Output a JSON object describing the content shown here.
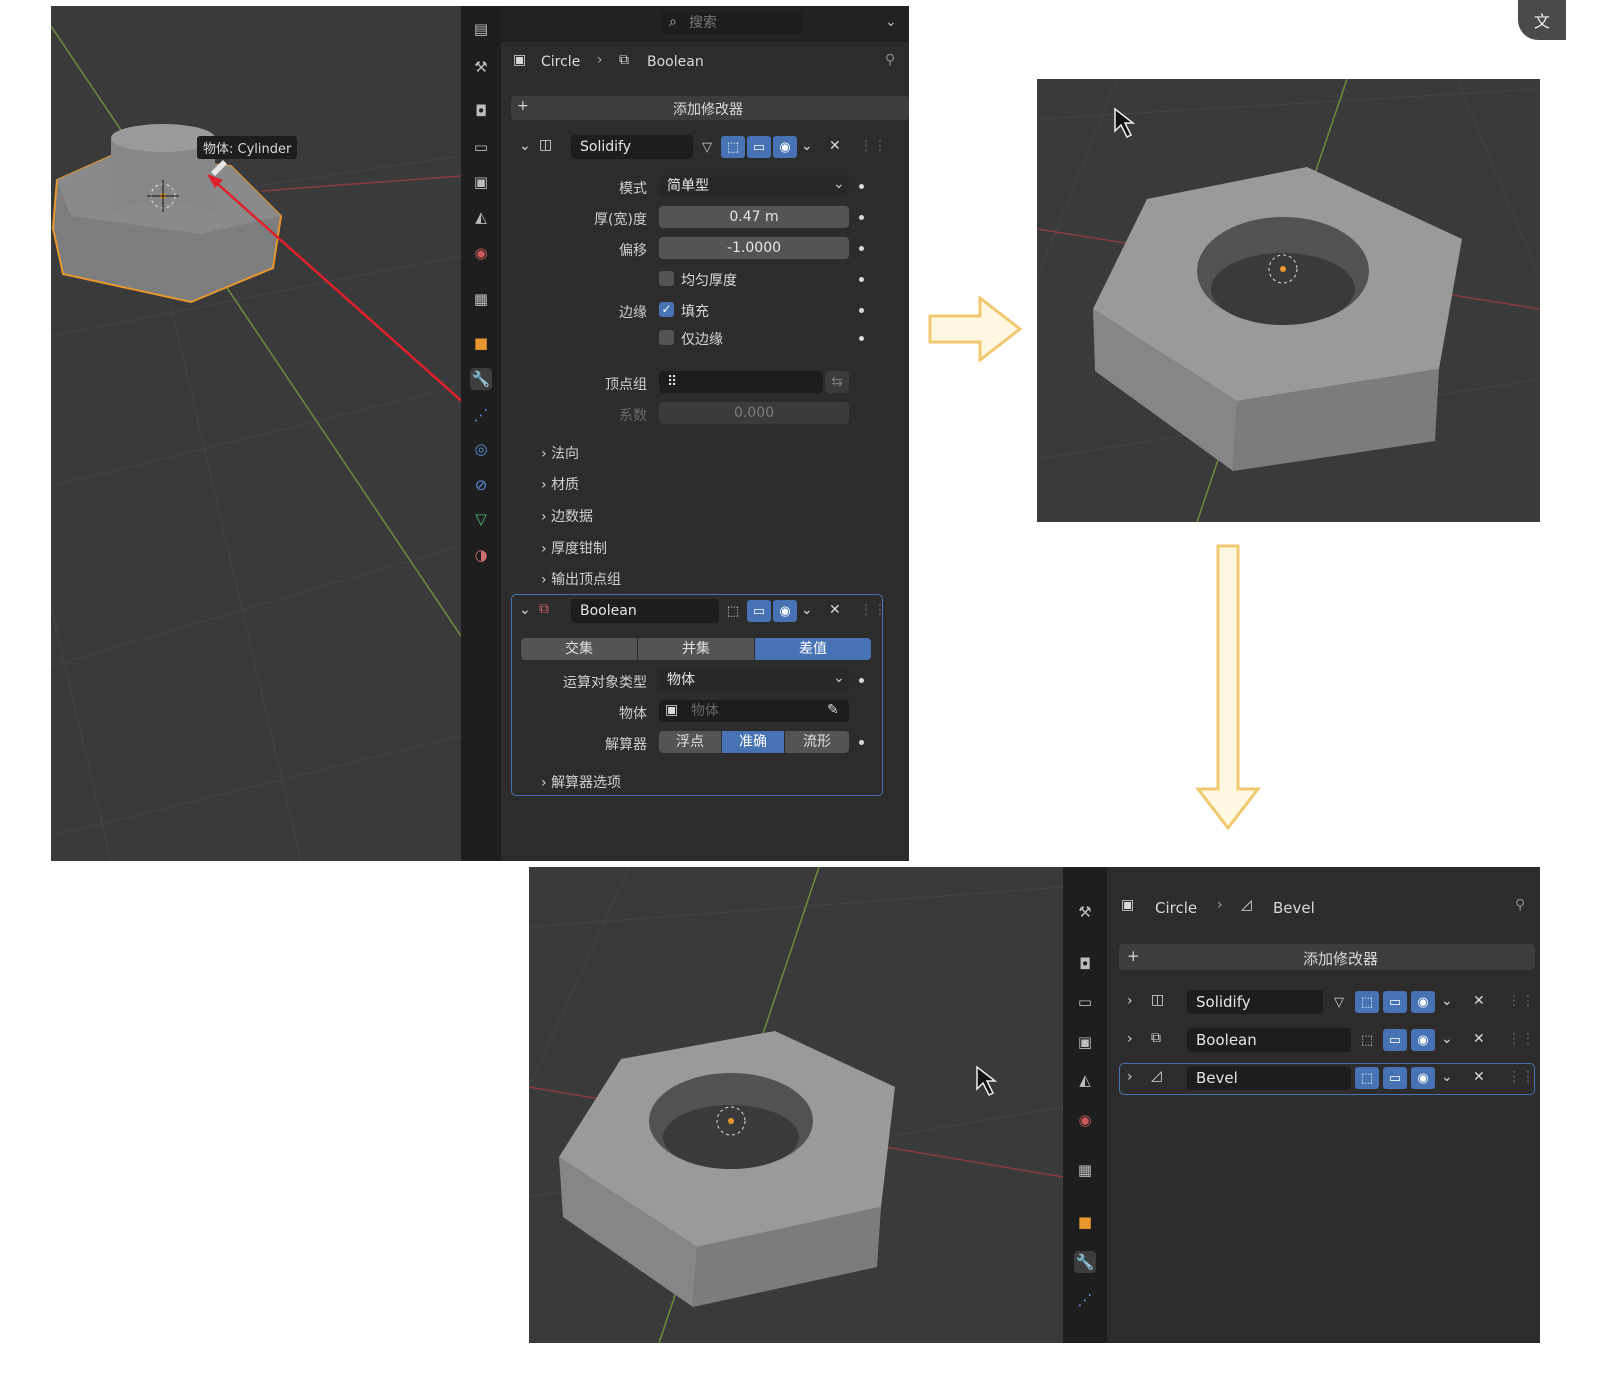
{
  "panel1": {
    "tooltip": "物体: Cylinder",
    "header": {
      "search_placeholder": "搜索"
    },
    "breadcrumb": {
      "object": "Circle",
      "modifier": "Boolean"
    },
    "add_modifier": "添加修改器",
    "solidify": {
      "name": "Solidify",
      "rows": [
        {
          "label": "模式",
          "value": "简单型"
        },
        {
          "label": "厚(宽)度",
          "value": "0.47 m"
        },
        {
          "label": "偏移",
          "value": "-1.0000"
        }
      ],
      "even_thickness": "均匀厚度",
      "rim_label": "边缘",
      "fill": "填充",
      "rim_only": "仅边缘",
      "vgroup_label": "顶点组",
      "factor_label": "系数",
      "factor_value": "0.000",
      "sections": [
        "法向",
        "材质",
        "边数据",
        "厚度钳制",
        "输出顶点组"
      ]
    },
    "boolean": {
      "name": "Boolean",
      "ops": [
        "交集",
        "并集",
        "差值"
      ],
      "operand_label": "运算对象类型",
      "operand_value": "物体",
      "object_label": "物体",
      "object_placeholder": "物体",
      "solver_label": "解算器",
      "solvers": [
        "浮点",
        "准确",
        "流形"
      ],
      "solver_options": "解算器选项"
    }
  },
  "panel3": {
    "breadcrumb": {
      "object": "Circle",
      "modifier": "Bevel"
    },
    "add_modifier": "添加修改器",
    "modifiers": [
      "Solidify",
      "Boolean",
      "Bevel"
    ]
  },
  "icons": {
    "corner": "translate-icon"
  },
  "colors": {
    "accent": "#4772b3",
    "selection": "#e8962e",
    "arrow": "#f6d58a",
    "pointer_line": "#e0202a"
  }
}
